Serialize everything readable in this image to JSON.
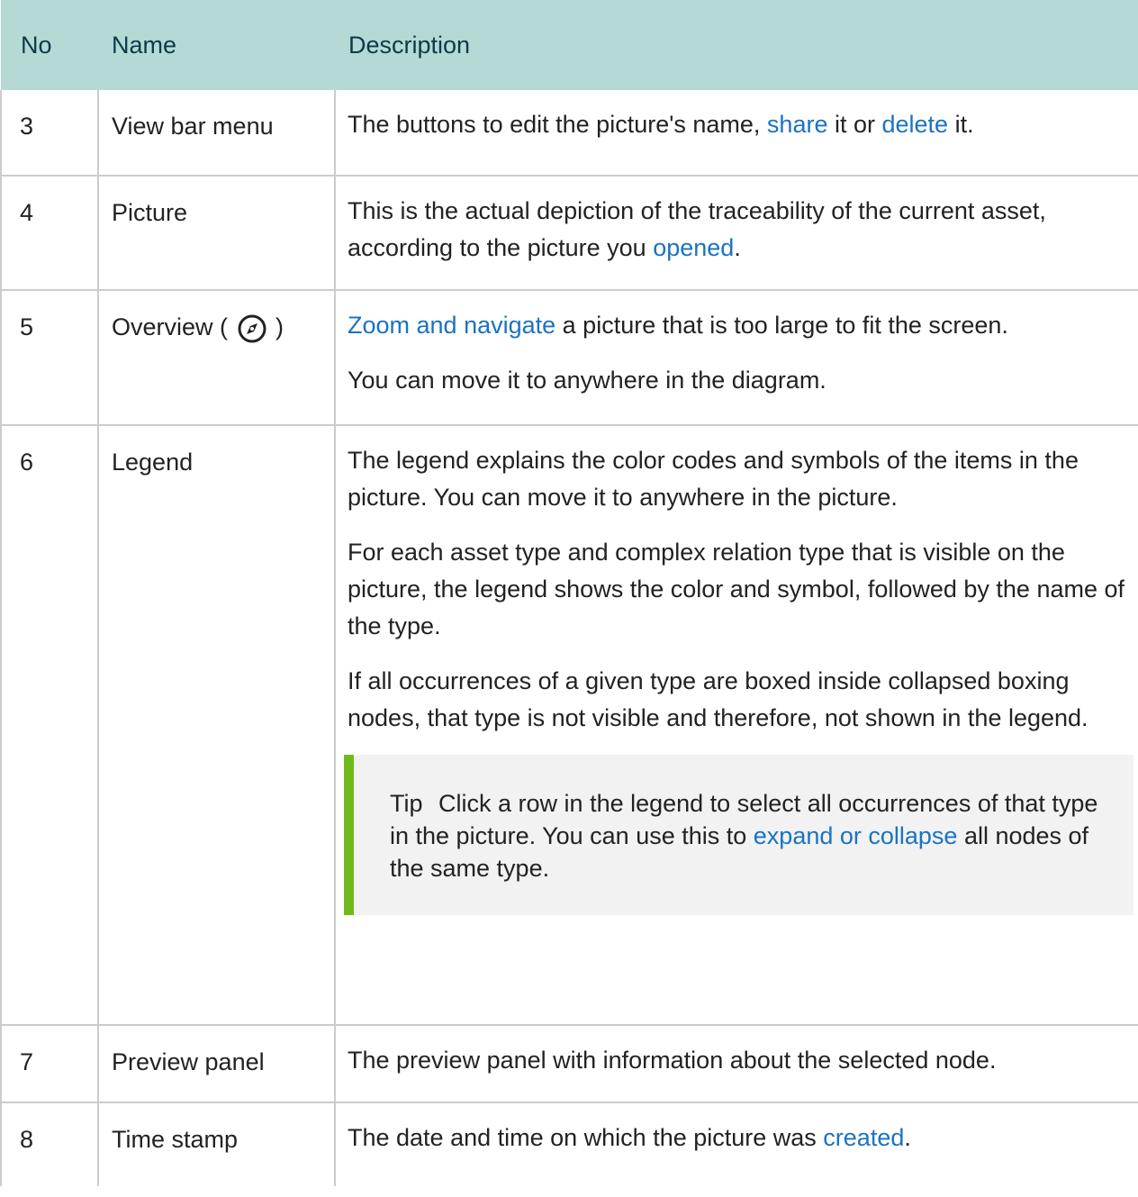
{
  "header": {
    "no": "No",
    "name": "Name",
    "description": "Description"
  },
  "rows": [
    {
      "no": "3",
      "name": "View bar menu",
      "desc": {
        "t1": "The buttons to edit the picture's name, ",
        "link1": "share",
        "t2": " it or ",
        "link2": "delete",
        "t3": " it."
      }
    },
    {
      "no": "4",
      "name": "Picture",
      "desc": {
        "t1": "This is the actual depiction of the traceability of the current asset, according to the picture you ",
        "link1": "opened",
        "t2": "."
      }
    },
    {
      "no": "5",
      "name_prefix": "Overview (",
      "name_suffix": ")",
      "icon": "compass-icon",
      "desc": {
        "link1": "Zoom and navigate",
        "t1": " a picture that is too large to fit the screen.",
        "p2": "You can move it to anywhere in the diagram."
      }
    },
    {
      "no": "6",
      "name": "Legend",
      "desc": {
        "p1": "The legend explains the color codes and symbols of the items in the picture. You can move it to anywhere in the picture.",
        "p2": "For each asset type and complex relation type that is visible on the picture, the legend shows the color and symbol, followed by the name of the type.",
        "p3": "If all occurrences of a given type are boxed inside collapsed boxing nodes, that type is not visible and therefore, not shown in the legend.",
        "tip": {
          "label": "Tip",
          "t1": "Click a row in the legend to select all occurrences of that type in the picture. You can use this to ",
          "link1": "expand or collapse",
          "t2": " all nodes of the same type."
        }
      }
    },
    {
      "no": "7",
      "name": "Preview panel",
      "desc": {
        "t1": "The preview panel with information about the selected node."
      }
    },
    {
      "no": "8",
      "name": "Time stamp",
      "desc": {
        "t1": "The date and time on which the picture was ",
        "link1": "created",
        "t2": "."
      }
    }
  ],
  "colors": {
    "header_bg": "#b5d9d4",
    "header_text": "#0b3a4a",
    "link": "#1a73c2",
    "tip_accent": "#6fba1c",
    "tip_bg": "#f2f2f2",
    "border": "#cccccc"
  }
}
